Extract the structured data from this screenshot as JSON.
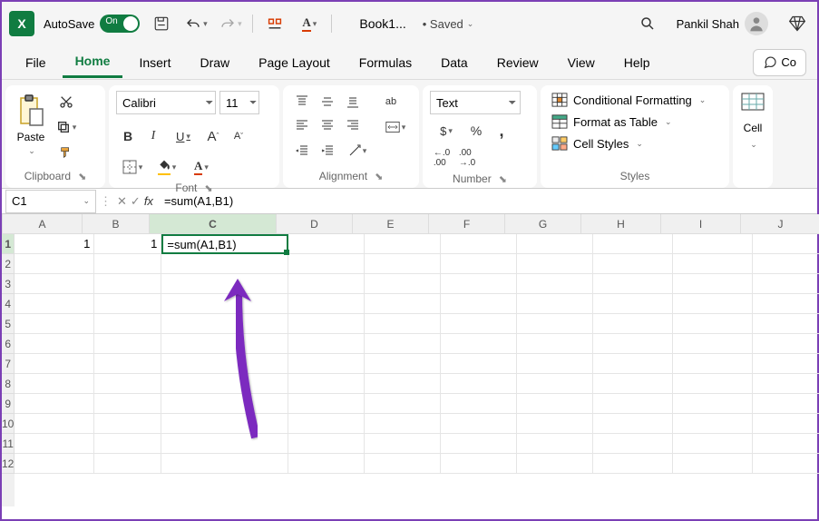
{
  "titlebar": {
    "autosave_label": "AutoSave",
    "autosave_on": "On",
    "doc_name": "Book1...",
    "saved_label": "• Saved",
    "user_name": "Pankil Shah"
  },
  "tabs": [
    "File",
    "Home",
    "Insert",
    "Draw",
    "Page Layout",
    "Formulas",
    "Data",
    "Review",
    "View",
    "Help"
  ],
  "active_tab": "Home",
  "comments_label": "Co",
  "ribbon": {
    "clipboard": {
      "paste": "Paste",
      "label": "Clipboard"
    },
    "font": {
      "name": "Calibri",
      "size": "11",
      "label": "Font",
      "bold": "B",
      "italic": "I",
      "underline": "U",
      "grow": "A",
      "shrink": "A"
    },
    "alignment": {
      "label": "Alignment",
      "wrap": "ab"
    },
    "number": {
      "format": "Text",
      "label": "Number",
      "currency": "$",
      "percent": "%",
      "comma": ","
    },
    "styles": {
      "cond": "Conditional Formatting",
      "table": "Format as Table",
      "cell": "Cell Styles",
      "label": "Styles"
    },
    "cells": {
      "label": "Cell"
    }
  },
  "formula_bar": {
    "name_box": "C1",
    "fx": "fx",
    "formula": "=sum(A1,B1)"
  },
  "grid": {
    "columns": [
      "A",
      "B",
      "C",
      "D",
      "E",
      "F",
      "G",
      "H",
      "I",
      "J"
    ],
    "rows": [
      "1",
      "2",
      "3",
      "4",
      "5",
      "6",
      "7",
      "8",
      "9",
      "10",
      "11",
      "12"
    ],
    "active_cell": "C1",
    "data": {
      "A1": "1",
      "B1": "1",
      "C1": "=sum(A1,B1)"
    }
  }
}
